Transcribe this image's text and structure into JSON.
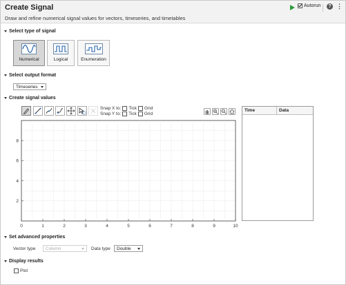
{
  "header": {
    "title": "Create Signal",
    "description": "Draw and refine numerical signal values for vectors, timeseries, and timetables",
    "autorun_label": "Autorun",
    "autorun_checked": true
  },
  "sections": {
    "type": "Select type of signal",
    "format": "Select output format",
    "create": "Create signal values",
    "advanced": "Set advanced properties",
    "display": "Display results"
  },
  "signal_types": [
    {
      "label": "Numerical",
      "selected": true
    },
    {
      "label": "Logical",
      "selected": false
    },
    {
      "label": "Enumeration",
      "selected": false
    }
  ],
  "output_format": {
    "value": "Timeseries"
  },
  "tools": [
    "pencil-icon",
    "line-icon",
    "spline-icon",
    "freehand-icon",
    "move-icon",
    "select-icon",
    "eraser-icon"
  ],
  "snap": {
    "x_label": "Snap X to:",
    "y_label": "Snap Y to:",
    "tick": "Tick",
    "grid": "Grid"
  },
  "table": {
    "col_time": "Time",
    "col_data": "Data"
  },
  "advanced": {
    "vector_type_label": "Vector type",
    "vector_type_value": "Column",
    "data_type_label": "Data type",
    "data_type_value": "Double"
  },
  "display": {
    "plot_label": "Plot",
    "plot_checked": false
  },
  "axes": {
    "x_ticks": [
      "0",
      "1",
      "2",
      "3",
      "4",
      "5",
      "6",
      "7",
      "8",
      "9",
      "10"
    ],
    "y_ticks": [
      "2",
      "4",
      "6",
      "8"
    ],
    "xlim": [
      0,
      10
    ],
    "ylim": [
      0,
      10
    ]
  }
}
